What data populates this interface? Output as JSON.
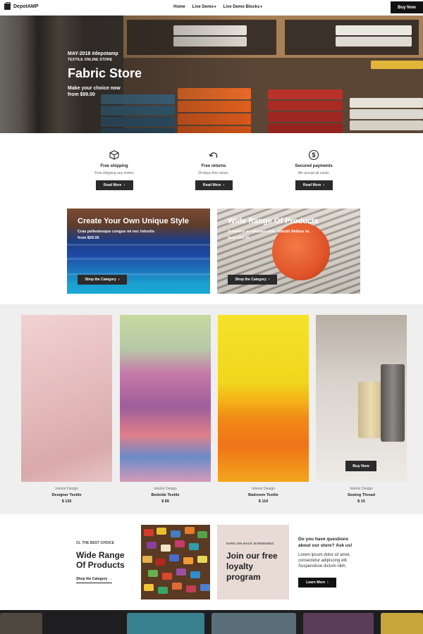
{
  "nav": {
    "logo": "DepotAMP",
    "menu": [
      {
        "label": "Home",
        "caret": ""
      },
      {
        "label": "Live Demo",
        "caret": "▾"
      },
      {
        "label": "Live Demo Blocks",
        "caret": "▾"
      }
    ],
    "buy_label": "Buy Now"
  },
  "hero": {
    "date_tag": "MAY-2018   #depotamp",
    "subtitle": "TEXTILE ONLINE STORE",
    "title": "Fabric Store",
    "line1": "Make your choice now",
    "line2": "from $99.00"
  },
  "features": [
    {
      "icon": "box-icon",
      "title": "Free shipping",
      "desc": "Free shipping any orders",
      "button": "Read More"
    },
    {
      "icon": "return-arrow-icon",
      "title": "Free returns",
      "desc": "30-days free return.",
      "button": "Read More"
    },
    {
      "icon": "dollar-circle-icon",
      "title": "Secured payments",
      "desc": "We accept all cards.",
      "button": "Read More"
    }
  ],
  "promos": [
    {
      "title": "Create Your Own Unique Style",
      "desc": "Cras pellentesque congue mi nec lobortis",
      "price": "from $29.00",
      "button": "Shop the Category"
    },
    {
      "title": "Wide Range Of Products",
      "desc": "Curabitur ac aliquam ante, blandit finibus ex",
      "price": "from $29.00",
      "button": "Shop the Category"
    }
  ],
  "products": [
    {
      "category": "Interior Design",
      "name": "Designer Textile",
      "price": "$ 135"
    },
    {
      "category": "Interior Design",
      "name": "Bedside Textile",
      "price": "$ 89"
    },
    {
      "category": "Interior Design",
      "name": "Badroom Textile",
      "price": "$ 119"
    },
    {
      "category": "Interior Design",
      "name": "Sewing Thread",
      "price": "$ 15",
      "button": "Buy Now"
    }
  ],
  "best": {
    "number": "01. THE BEST CHOICE",
    "title": "Wide Range Of Products",
    "link": "Shop the Category"
  },
  "loyalty": {
    "small": "EARN 10% BACK IN REWARDS",
    "title": "Join our free loyalty program"
  },
  "questions": {
    "title": "Do you have questions about our store? Ask us!",
    "desc": "Lorem ipsum dolor sit amet, consectetur adipiscing elit. Suspendisse dictum nibh.",
    "button": "Learn More"
  },
  "colors": {
    "dark_button": "#2b2b2b",
    "gallery_bg": "#efefef",
    "loyalty_bg": "#e8dbd6"
  }
}
